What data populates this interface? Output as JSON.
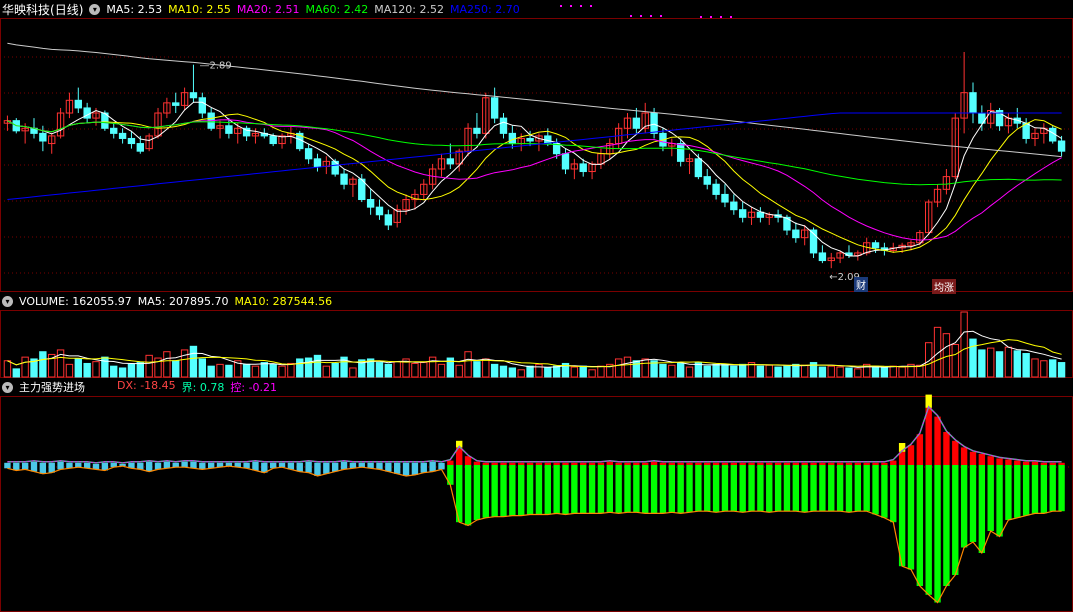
{
  "colors": {
    "bg": "#000000",
    "up": "#ff3232",
    "down": "#54ffff",
    "ma5": "#ffffff",
    "ma10": "#ffff00",
    "ma20": "#ff00ff",
    "ma60": "#00ff00",
    "ma120": "#cccccc",
    "ma250": "#0000ff",
    "grid": "#7a0000",
    "dx_pos": "#ff0000",
    "dx_neg": "#00ff00",
    "dx_top": "#ffff00",
    "jie": "#00ffaa",
    "kong": "#ff00ff"
  },
  "price_panel": {
    "stock_name": "华映科技",
    "period": "(日线)",
    "ma": [
      {
        "label": "MA5:",
        "value": "2.53",
        "color": "#ffffff"
      },
      {
        "label": "MA10:",
        "value": "2.55",
        "color": "#ffff00"
      },
      {
        "label": "MA20:",
        "value": "2.51",
        "color": "#ff00ff"
      },
      {
        "label": "MA60:",
        "value": "2.42",
        "color": "#00ff00"
      },
      {
        "label": "MA120:",
        "value": "2.52",
        "color": "#cccccc"
      },
      {
        "label": "MA250:",
        "value": "2.70",
        "color": "#0000ff"
      }
    ],
    "high_label": "2.89",
    "low_label": "2.09",
    "markers": [
      {
        "text": "财",
        "color": "#ff3232"
      },
      {
        "text": "均涨",
        "color": "#ff3232"
      }
    ]
  },
  "volume_panel": {
    "items": [
      {
        "label": "VOLUME:",
        "value": "162055.97",
        "color": "#ffffff"
      },
      {
        "label": "MA5:",
        "value": "207895.70",
        "color": "#ffffff"
      },
      {
        "label": "MA10:",
        "value": "287544.56",
        "color": "#ffff00"
      }
    ]
  },
  "indicator_panel": {
    "name": "主力强势进场",
    "items": [
      {
        "label": "DX:",
        "value": "-18.45",
        "color": "#ff4444"
      },
      {
        "label": "界:",
        "value": "0.78",
        "color": "#00ffaa"
      },
      {
        "label": "控:",
        "value": "-0.21",
        "color": "#ff00ff"
      }
    ]
  },
  "chart_data": {
    "type": "candlestick",
    "ylim": [
      2.02,
      3.05
    ],
    "candles": [
      [
        2.66,
        2.69,
        2.63,
        2.67
      ],
      [
        2.67,
        2.68,
        2.62,
        2.63
      ],
      [
        2.63,
        2.66,
        2.58,
        2.64
      ],
      [
        2.64,
        2.68,
        2.6,
        2.62
      ],
      [
        2.62,
        2.65,
        2.55,
        2.59
      ],
      [
        2.58,
        2.62,
        2.54,
        2.61
      ],
      [
        2.61,
        2.72,
        2.6,
        2.7
      ],
      [
        2.7,
        2.78,
        2.68,
        2.75
      ],
      [
        2.75,
        2.8,
        2.7,
        2.72
      ],
      [
        2.72,
        2.74,
        2.66,
        2.68
      ],
      [
        2.68,
        2.72,
        2.65,
        2.7
      ],
      [
        2.7,
        2.71,
        2.63,
        2.64
      ],
      [
        2.64,
        2.66,
        2.6,
        2.62
      ],
      [
        2.62,
        2.64,
        2.58,
        2.6
      ],
      [
        2.6,
        2.63,
        2.56,
        2.58
      ],
      [
        2.58,
        2.61,
        2.54,
        2.55
      ],
      [
        2.56,
        2.62,
        2.55,
        2.61
      ],
      [
        2.61,
        2.72,
        2.6,
        2.7
      ],
      [
        2.7,
        2.76,
        2.68,
        2.74
      ],
      [
        2.74,
        2.78,
        2.7,
        2.73
      ],
      [
        2.73,
        2.8,
        2.71,
        2.78
      ],
      [
        2.78,
        2.89,
        2.74,
        2.76
      ],
      [
        2.76,
        2.78,
        2.68,
        2.7
      ],
      [
        2.7,
        2.72,
        2.63,
        2.64
      ],
      [
        2.64,
        2.67,
        2.6,
        2.65
      ],
      [
        2.65,
        2.68,
        2.6,
        2.62
      ],
      [
        2.62,
        2.66,
        2.58,
        2.64
      ],
      [
        2.64,
        2.65,
        2.59,
        2.61
      ],
      [
        2.61,
        2.64,
        2.58,
        2.62
      ],
      [
        2.62,
        2.64,
        2.6,
        2.61
      ],
      [
        2.61,
        2.62,
        2.57,
        2.58
      ],
      [
        2.58,
        2.62,
        2.56,
        2.61
      ],
      [
        2.61,
        2.65,
        2.58,
        2.62
      ],
      [
        2.62,
        2.63,
        2.55,
        2.56
      ],
      [
        2.56,
        2.58,
        2.5,
        2.52
      ],
      [
        2.52,
        2.54,
        2.47,
        2.49
      ],
      [
        2.49,
        2.53,
        2.46,
        2.51
      ],
      [
        2.51,
        2.52,
        2.45,
        2.46
      ],
      [
        2.46,
        2.48,
        2.4,
        2.42
      ],
      [
        2.42,
        2.45,
        2.37,
        2.44
      ],
      [
        2.44,
        2.46,
        2.35,
        2.36
      ],
      [
        2.36,
        2.4,
        2.3,
        2.33
      ],
      [
        2.33,
        2.36,
        2.28,
        2.3
      ],
      [
        2.3,
        2.32,
        2.24,
        2.26
      ],
      [
        2.27,
        2.34,
        2.25,
        2.32
      ],
      [
        2.32,
        2.38,
        2.3,
        2.36
      ],
      [
        2.36,
        2.4,
        2.32,
        2.38
      ],
      [
        2.38,
        2.44,
        2.36,
        2.42
      ],
      [
        2.42,
        2.5,
        2.4,
        2.48
      ],
      [
        2.48,
        2.54,
        2.45,
        2.52
      ],
      [
        2.52,
        2.58,
        2.48,
        2.5
      ],
      [
        2.5,
        2.56,
        2.47,
        2.55
      ],
      [
        2.55,
        2.66,
        2.53,
        2.64
      ],
      [
        2.64,
        2.7,
        2.6,
        2.62
      ],
      [
        2.62,
        2.78,
        2.6,
        2.76
      ],
      [
        2.76,
        2.8,
        2.66,
        2.68
      ],
      [
        2.68,
        2.7,
        2.6,
        2.62
      ],
      [
        2.62,
        2.65,
        2.56,
        2.58
      ],
      [
        2.58,
        2.62,
        2.55,
        2.6
      ],
      [
        2.6,
        2.63,
        2.57,
        2.59
      ],
      [
        2.59,
        2.62,
        2.55,
        2.61
      ],
      [
        2.61,
        2.64,
        2.57,
        2.58
      ],
      [
        2.58,
        2.6,
        2.52,
        2.54
      ],
      [
        2.54,
        2.56,
        2.46,
        2.48
      ],
      [
        2.48,
        2.52,
        2.44,
        2.5
      ],
      [
        2.5,
        2.52,
        2.45,
        2.47
      ],
      [
        2.47,
        2.51,
        2.44,
        2.5
      ],
      [
        2.5,
        2.56,
        2.48,
        2.54
      ],
      [
        2.54,
        2.6,
        2.52,
        2.58
      ],
      [
        2.58,
        2.66,
        2.56,
        2.64
      ],
      [
        2.64,
        2.7,
        2.6,
        2.68
      ],
      [
        2.68,
        2.72,
        2.62,
        2.64
      ],
      [
        2.64,
        2.74,
        2.62,
        2.7
      ],
      [
        2.7,
        2.72,
        2.6,
        2.62
      ],
      [
        2.62,
        2.64,
        2.55,
        2.57
      ],
      [
        2.57,
        2.6,
        2.53,
        2.58
      ],
      [
        2.58,
        2.6,
        2.49,
        2.51
      ],
      [
        2.51,
        2.54,
        2.46,
        2.52
      ],
      [
        2.52,
        2.54,
        2.44,
        2.45
      ],
      [
        2.45,
        2.48,
        2.4,
        2.42
      ],
      [
        2.42,
        2.44,
        2.36,
        2.38
      ],
      [
        2.38,
        2.42,
        2.33,
        2.35
      ],
      [
        2.35,
        2.38,
        2.3,
        2.32
      ],
      [
        2.32,
        2.35,
        2.27,
        2.29
      ],
      [
        2.29,
        2.33,
        2.26,
        2.31
      ],
      [
        2.31,
        2.33,
        2.27,
        2.29
      ],
      [
        2.29,
        2.31,
        2.26,
        2.3
      ],
      [
        2.3,
        2.32,
        2.27,
        2.29
      ],
      [
        2.29,
        2.3,
        2.22,
        2.24
      ],
      [
        2.24,
        2.27,
        2.19,
        2.21
      ],
      [
        2.21,
        2.26,
        2.18,
        2.24
      ],
      [
        2.24,
        2.25,
        2.13,
        2.15
      ],
      [
        2.15,
        2.18,
        2.11,
        2.12
      ],
      [
        2.12,
        2.15,
        2.09,
        2.13
      ],
      [
        2.13,
        2.16,
        2.11,
        2.15
      ],
      [
        2.15,
        2.18,
        2.13,
        2.14
      ],
      [
        2.14,
        2.16,
        2.12,
        2.15
      ],
      [
        2.15,
        2.21,
        2.14,
        2.19
      ],
      [
        2.19,
        2.2,
        2.15,
        2.17
      ],
      [
        2.17,
        2.19,
        2.14,
        2.16
      ],
      [
        2.16,
        2.19,
        2.15,
        2.17
      ],
      [
        2.17,
        2.19,
        2.15,
        2.18
      ],
      [
        2.18,
        2.2,
        2.16,
        2.19
      ],
      [
        2.19,
        2.24,
        2.18,
        2.23
      ],
      [
        2.23,
        2.36,
        2.22,
        2.35
      ],
      [
        2.35,
        2.42,
        2.33,
        2.4
      ],
      [
        2.4,
        2.48,
        2.38,
        2.45
      ],
      [
        2.45,
        2.7,
        2.44,
        2.68
      ],
      [
        2.68,
        2.94,
        2.62,
        2.78
      ],
      [
        2.78,
        2.82,
        2.66,
        2.7
      ],
      [
        2.7,
        2.73,
        2.63,
        2.66
      ],
      [
        2.66,
        2.74,
        2.64,
        2.71
      ],
      [
        2.71,
        2.72,
        2.63,
        2.65
      ],
      [
        2.65,
        2.7,
        2.62,
        2.68
      ],
      [
        2.68,
        2.72,
        2.64,
        2.66
      ],
      [
        2.66,
        2.68,
        2.58,
        2.6
      ],
      [
        2.6,
        2.64,
        2.57,
        2.62
      ],
      [
        2.62,
        2.66,
        2.58,
        2.64
      ],
      [
        2.64,
        2.65,
        2.58,
        2.59
      ],
      [
        2.59,
        2.61,
        2.53,
        2.55
      ]
    ],
    "volume": [
      18,
      9,
      22,
      20,
      28,
      25,
      30,
      14,
      20,
      15,
      17,
      22,
      12,
      10,
      14,
      16,
      24,
      21,
      28,
      18,
      30,
      34,
      20,
      12,
      14,
      13,
      18,
      14,
      12,
      16,
      14,
      12,
      15,
      20,
      21,
      24,
      12,
      15,
      22,
      10,
      19,
      20,
      16,
      14,
      17,
      20,
      15,
      16,
      22,
      14,
      21,
      13,
      28,
      17,
      20,
      14,
      12,
      10,
      8,
      12,
      14,
      10,
      12,
      15,
      11,
      12,
      8,
      12,
      14,
      20,
      22,
      18,
      20,
      18,
      14,
      13,
      15,
      11,
      16,
      12,
      14,
      14,
      12,
      14,
      16,
      12,
      13,
      11,
      12,
      14,
      13,
      16,
      11,
      12,
      11,
      10,
      9,
      14,
      12,
      10,
      12,
      11,
      14,
      13,
      38,
      55,
      48,
      36,
      72,
      42,
      30,
      32,
      28,
      33,
      29,
      26,
      20,
      18,
      19,
      16
    ],
    "dx": [
      -3,
      -5,
      -4,
      -6,
      -8,
      -7,
      -4,
      -3,
      -2,
      -3,
      -4,
      -5,
      -2,
      -1,
      -3,
      -4,
      -6,
      -4,
      -3,
      -2,
      -2,
      -3,
      -4,
      -3,
      -2,
      -1,
      -2,
      -3,
      -5,
      -7,
      -3,
      -2,
      -4,
      -6,
      -7,
      -10,
      -8,
      -6,
      -4,
      -3,
      -2,
      -3,
      -4,
      -6,
      -8,
      -10,
      -9,
      -7,
      -6,
      -4,
      -18,
      -52,
      -55,
      -50,
      -48,
      -47,
      -47,
      -46,
      -46,
      -45,
      -45,
      -45,
      -44,
      -45,
      -44,
      -44,
      -44,
      -44,
      -43,
      -44,
      -43,
      -43,
      -44,
      -44,
      -44,
      -43,
      -44,
      -43,
      -42,
      -42,
      -43,
      -42,
      -42,
      -43,
      -42,
      -42,
      -43,
      -42,
      -42,
      -42,
      -43,
      -42,
      -42,
      -42,
      -42,
      -43,
      -42,
      -42,
      -45,
      -48,
      -52,
      -92,
      -95,
      -110,
      -118,
      -125,
      -110,
      -100,
      -75,
      -70,
      -80,
      -60,
      -65,
      -50,
      -48,
      -46,
      -44,
      -44,
      -42,
      -42
    ],
    "dx_pos": [
      2,
      2,
      2,
      3,
      2,
      2,
      3,
      2,
      2,
      2,
      1,
      2,
      2,
      1,
      2,
      2,
      3,
      2,
      3,
      2,
      3,
      3,
      2,
      2,
      2,
      2,
      2,
      2,
      3,
      2,
      2,
      2,
      2,
      2,
      3,
      2,
      2,
      2,
      3,
      2,
      2,
      2,
      2,
      2,
      2,
      2,
      2,
      2,
      3,
      2,
      4,
      16,
      8,
      3,
      2,
      2,
      2,
      2,
      2,
      2,
      2,
      2,
      2,
      2,
      2,
      2,
      2,
      2,
      3,
      2,
      2,
      2,
      2,
      3,
      2,
      2,
      2,
      2,
      2,
      2,
      2,
      2,
      2,
      2,
      2,
      2,
      2,
      2,
      2,
      2,
      2,
      2,
      2,
      2,
      2,
      2,
      2,
      2,
      2,
      2,
      4,
      12,
      18,
      28,
      52,
      44,
      30,
      22,
      16,
      12,
      10,
      8,
      6,
      5,
      4,
      3,
      3,
      2,
      2,
      2
    ],
    "dx_top": [
      0,
      0,
      0,
      0,
      0,
      0,
      0,
      0,
      0,
      0,
      0,
      0,
      0,
      0,
      0,
      0,
      0,
      0,
      0,
      0,
      0,
      0,
      0,
      0,
      0,
      0,
      0,
      0,
      0,
      0,
      0,
      0,
      0,
      0,
      0,
      0,
      0,
      0,
      0,
      0,
      0,
      0,
      0,
      0,
      0,
      0,
      0,
      0,
      0,
      0,
      0,
      6,
      0,
      0,
      0,
      0,
      0,
      0,
      0,
      0,
      0,
      0,
      0,
      0,
      0,
      0,
      0,
      0,
      0,
      0,
      0,
      0,
      0,
      0,
      0,
      0,
      0,
      0,
      0,
      0,
      0,
      0,
      0,
      0,
      0,
      0,
      0,
      0,
      0,
      0,
      0,
      0,
      0,
      0,
      0,
      0,
      0,
      0,
      0,
      0,
      0,
      8,
      0,
      0,
      12,
      0,
      0,
      0,
      0,
      0,
      0,
      0,
      0,
      0,
      0,
      0,
      0,
      0,
      0,
      0
    ]
  }
}
